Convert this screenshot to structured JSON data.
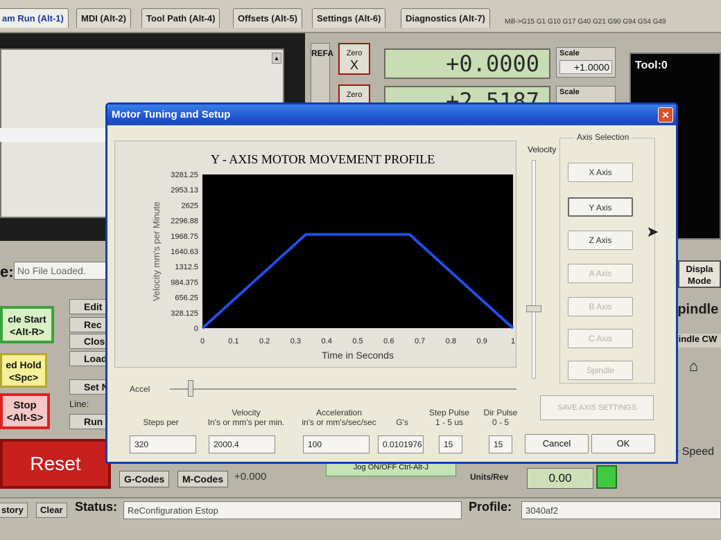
{
  "tabs": [
    {
      "label": "am Run (Alt-1)",
      "active": true
    },
    {
      "label": "MDI (Alt-2)",
      "active": false
    },
    {
      "label": "Tool Path (Alt-4)",
      "active": false
    },
    {
      "label": "Offsets (Alt-5)",
      "active": false
    },
    {
      "label": "Settings (Alt-6)",
      "active": false
    },
    {
      "label": "Diagnostics (Alt-7)",
      "active": false
    }
  ],
  "gcode_modal_line": "Mill->G15 G1 G10 G17 G40 G21 G90 G94 G54 G49",
  "ref_label": "REFA",
  "zero_buttons": [
    {
      "top": "Zero",
      "axis": "X"
    },
    {
      "top": "Zero",
      "axis": ""
    }
  ],
  "dro": {
    "x_value": "+0.0000",
    "y_value": "+2.5187"
  },
  "scale": {
    "label": "Scale",
    "x_value": "+1.0000"
  },
  "tool_label": "Tool:0",
  "file": {
    "label": "e:",
    "value": "No File Loaded."
  },
  "cycle_start": {
    "line1": "cle Start",
    "line2": "<Alt-R>"
  },
  "feed_hold": {
    "line1": "ed Hold",
    "line2": "<Spc>"
  },
  "stop": {
    "line1": "Stop",
    "line2": "<Alt-S>"
  },
  "reset_label": "Reset",
  "side_buttons": [
    "Edit",
    "Rec",
    "Close",
    "Load",
    "Set N",
    "Run F"
  ],
  "line_label": "Line:",
  "gcodes_label": "G-Codes",
  "mcodes_label": "M-Codes",
  "gcode_value": "+0.000",
  "jog_label": "Jog ON/OFF Ctrl-Alt-J",
  "units_rev_label": "Units/Rev",
  "units_rev_value": "0.00",
  "display_mode": {
    "line1": "Displa",
    "line2": "Mode"
  },
  "spindle_label": "Spindle",
  "spindle_cw_label": "Spindle CW",
  "spindle_speed_label": "dle Speed",
  "bottom": {
    "history_label": "story",
    "clear_label": "Clear",
    "status_label": "Status:",
    "status_value": "ReConfiguration Estop",
    "profile_label": "Profile:",
    "profile_value": "3040af2"
  },
  "dialog": {
    "title": "Motor Tuning and Setup",
    "close_glyph": "✕",
    "velocity_label": "Velocity",
    "axis_selection_label": "Axis Selection",
    "axis_buttons": [
      {
        "label": "X Axis",
        "state": "enabled"
      },
      {
        "label": "Y Axis",
        "state": "selected"
      },
      {
        "label": "Z Axis",
        "state": "enabled"
      },
      {
        "label": "A Axis",
        "state": "disabled"
      },
      {
        "label": "B Axis",
        "state": "disabled"
      },
      {
        "label": "C Axis",
        "state": "disabled"
      },
      {
        "label": "Spindle",
        "state": "disabled"
      }
    ],
    "accel_label": "Accel",
    "save_label": "SAVE AXIS SETTINGS",
    "cancel_label": "Cancel",
    "ok_label": "OK",
    "headers": {
      "steps": "Steps per",
      "velocity_1": "Velocity",
      "velocity_2": "In's or mm's per min.",
      "accel_1": "Acceleration",
      "accel_2": "in's or mm's/sec/sec",
      "gs": "G's",
      "step_pulse_1": "Step Pulse",
      "step_pulse_2": "1 - 5 us",
      "dir_pulse_1": "Dir Pulse",
      "dir_pulse_2": "0 - 5"
    },
    "values": {
      "steps": "320",
      "velocity": "2000.4",
      "acceleration": "100",
      "gs": "0.0101976",
      "step_pulse": "15",
      "dir_pulse": "15"
    }
  },
  "chart_data": {
    "type": "line",
    "title": "Y - AXIS MOTOR MOVEMENT PROFILE",
    "xlabel": "Time in Seconds",
    "ylabel": "Velocity mm's per Minute",
    "xlim": [
      0,
      1
    ],
    "ylim": [
      0,
      3281.25
    ],
    "x_ticks": [
      "0",
      "0.1",
      "0.2",
      "0.3",
      "0.4",
      "0.5",
      "0.6",
      "0.7",
      "0.8",
      "0.9",
      "1"
    ],
    "y_ticks": [
      "0",
      "328.125",
      "656.25",
      "984.375",
      "1312.5",
      "1640.63",
      "1968.75",
      "2296.88",
      "2625",
      "2953.13",
      "3281.25"
    ],
    "grid": false,
    "plot_background": "#000000",
    "line_color": "#1f4fe8",
    "x": [
      0,
      0.333,
      0.667,
      1
    ],
    "values": [
      0,
      2000.4,
      2000.4,
      0
    ]
  }
}
